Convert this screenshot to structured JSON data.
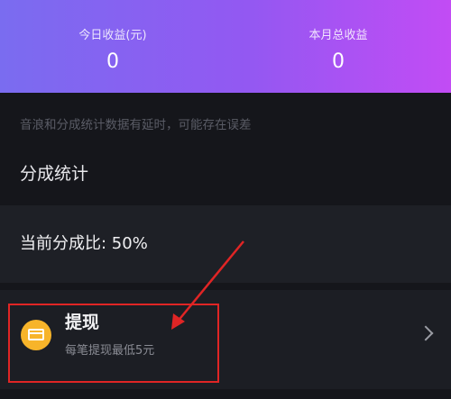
{
  "header": {
    "today_label": "今日收益(元)",
    "today_value": "0",
    "month_label": "本月总收益",
    "month_value": "0"
  },
  "notice": "音浪和分成统计数据有延时，可能存在误差",
  "section_title": "分成统计",
  "ratio_text": "当前分成比: 50%",
  "withdraw": {
    "title": "提现",
    "subtitle": "每笔提现最低5元"
  },
  "colors": {
    "accent_gradient_start": "#7a6cf0",
    "accent_gradient_end": "#c24cf4",
    "icon_bg": "#f7b42a",
    "annotation": "#e02525"
  },
  "icons": {
    "withdraw_icon": "card-icon",
    "row_chevron": "chevron-right-icon"
  }
}
